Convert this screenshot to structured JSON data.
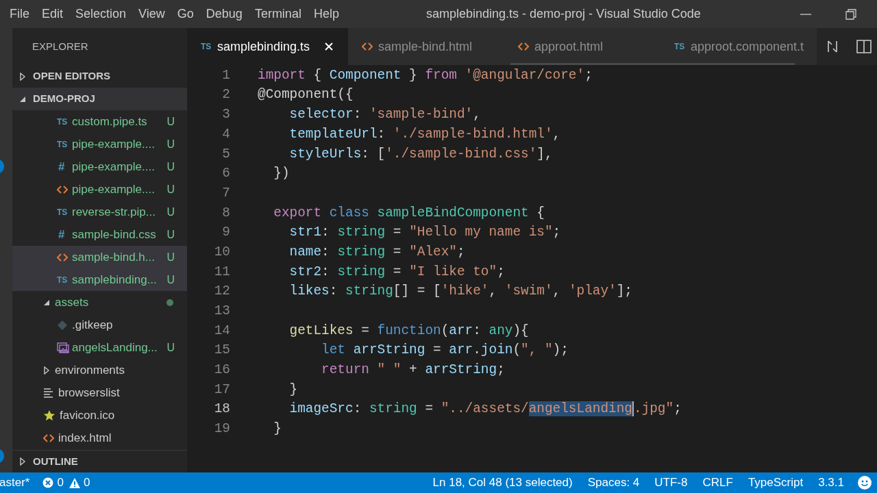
{
  "menu": [
    "File",
    "Edit",
    "Selection",
    "View",
    "Go",
    "Debug",
    "Terminal",
    "Help"
  ],
  "window": {
    "title": "samplebinding.ts - demo-proj - Visual Studio Code"
  },
  "sidebar": {
    "title": "EXPLORER",
    "sections": [
      {
        "label": "OPEN EDITORS",
        "expanded": false
      },
      {
        "label": "DEMO-PROJ",
        "expanded": true
      }
    ],
    "tree": [
      {
        "children": [
          {
            "label": "custom.pipe.ts",
            "icon": {
              "kind": "ts",
              "text": "TS"
            },
            "status": "U",
            "color": "#73c991",
            "selected": false
          },
          {
            "label": "pipe-example....",
            "icon": {
              "kind": "ts",
              "text": "TS"
            },
            "status": "U",
            "color": "#73c991",
            "selected": false
          },
          {
            "label": "pipe-example....",
            "icon": {
              "kind": "css",
              "text": "#"
            },
            "status": "U",
            "color": "#73c991",
            "selected": false
          },
          {
            "label": "pipe-example....",
            "icon": {
              "kind": "html"
            },
            "status": "U",
            "color": "#73c991",
            "selected": false
          },
          {
            "label": "reverse-str.pip...",
            "icon": {
              "kind": "ts",
              "text": "TS"
            },
            "status": "U",
            "color": "#73c991",
            "selected": false
          },
          {
            "label": "sample-bind.css",
            "icon": {
              "kind": "css",
              "text": "#"
            },
            "status": "U",
            "color": "#73c991",
            "selected": false
          },
          {
            "label": "sample-bind.h...",
            "icon": {
              "kind": "html"
            },
            "status": "U",
            "color": "#73c991",
            "selected": true
          },
          {
            "label": "samplebinding...",
            "icon": {
              "kind": "ts",
              "text": "TS"
            },
            "status": "U",
            "color": "#73c991",
            "selected": true
          }
        ]
      },
      {
        "label": "assets",
        "expanded": true,
        "color": "#73c991",
        "modified_dot": true,
        "selected": false,
        "children": [
          {
            "label": ".gitkeep",
            "icon": {
              "kind": "git"
            },
            "color": "#cccccc",
            "selected": false
          },
          {
            "label": "angelsLanding...",
            "icon": {
              "kind": "image"
            },
            "status": "U",
            "color": "#73c991",
            "selected": false
          }
        ]
      },
      {
        "label": "environments",
        "expanded": false,
        "color": "#cccccc",
        "selected": false
      },
      {
        "label": "browserslist",
        "icon": {
          "kind": "lines"
        },
        "color": "#cccccc",
        "selected": false
      },
      {
        "label": "favicon.ico",
        "icon": {
          "kind": "star"
        },
        "color": "#cccccc",
        "selected": false
      },
      {
        "label": "index.html",
        "icon": {
          "kind": "html"
        },
        "color": "#cccccc",
        "selected": false
      }
    ],
    "footer": {
      "label": "OUTLINE",
      "expanded": false
    }
  },
  "tabs": [
    {
      "label": "samplebinding.ts",
      "icon": {
        "kind": "ts",
        "text": "TS"
      },
      "selected": true
    },
    {
      "label": "sample-bind.html",
      "icon": {
        "kind": "html"
      },
      "selected": false
    },
    {
      "label": "approot.html",
      "icon": {
        "kind": "html"
      },
      "selected": false
    },
    {
      "label": "approot.component.t",
      "icon": {
        "kind": "ts",
        "text": "TS"
      },
      "selected": false
    }
  ],
  "editor": {
    "lines": [
      {
        "number": "1",
        "current": false,
        "tokens": [
          {
            "text": "import",
            "kind": "keyword"
          },
          {
            "text": " { ",
            "kind": "plain"
          },
          {
            "text": "Component",
            "kind": "variable"
          },
          {
            "text": " } ",
            "kind": "plain"
          },
          {
            "text": "from ",
            "kind": "keyword"
          },
          {
            "text": "'@angular/core'",
            "kind": "string"
          },
          {
            "text": ";",
            "kind": "plain"
          }
        ]
      },
      {
        "number": "2",
        "current": false,
        "tokens": [
          {
            "text": "@Component({",
            "kind": "plain"
          }
        ]
      },
      {
        "number": "3",
        "current": false,
        "tokens": [
          {
            "text": "    selector",
            "kind": "variable"
          },
          {
            "text": ": ",
            "kind": "plain"
          },
          {
            "text": "'sample-bind'",
            "kind": "string"
          },
          {
            "text": ",",
            "kind": "plain"
          }
        ]
      },
      {
        "number": "4",
        "current": false,
        "tokens": [
          {
            "text": "    templateUrl",
            "kind": "variable"
          },
          {
            "text": ": ",
            "kind": "plain"
          },
          {
            "text": "'./sample-bind.html'",
            "kind": "string"
          },
          {
            "text": ",",
            "kind": "plain"
          }
        ]
      },
      {
        "number": "5",
        "current": false,
        "tokens": [
          {
            "text": "    styleUrls",
            "kind": "variable"
          },
          {
            "text": ": [",
            "kind": "plain"
          },
          {
            "text": "'./sample-bind.css'",
            "kind": "string"
          },
          {
            "text": "],",
            "kind": "plain"
          }
        ]
      },
      {
        "number": "6",
        "current": false,
        "tokens": [
          {
            "text": "  })",
            "kind": "plain"
          }
        ]
      },
      {
        "number": "7",
        "current": false
      },
      {
        "number": "8",
        "current": false,
        "tokens": [
          {
            "text": "  export ",
            "kind": "keyword"
          },
          {
            "text": "class ",
            "kind": "storage"
          },
          {
            "text": "sampleBindComponent",
            "kind": "type"
          },
          {
            "text": " {",
            "kind": "plain"
          }
        ]
      },
      {
        "number": "9",
        "current": false,
        "tokens": [
          {
            "text": "    str1",
            "kind": "variable"
          },
          {
            "text": ": ",
            "kind": "plain"
          },
          {
            "text": "string",
            "kind": "type"
          },
          {
            "text": " = ",
            "kind": "plain"
          },
          {
            "text": "\"Hello my name is\"",
            "kind": "string"
          },
          {
            "text": ";",
            "kind": "plain"
          }
        ]
      },
      {
        "number": "10",
        "current": false,
        "tokens": [
          {
            "text": "    name",
            "kind": "variable"
          },
          {
            "text": ": ",
            "kind": "plain"
          },
          {
            "text": "string",
            "kind": "type"
          },
          {
            "text": " = ",
            "kind": "plain"
          },
          {
            "text": "\"Alex\"",
            "kind": "string"
          },
          {
            "text": ";",
            "kind": "plain"
          }
        ]
      },
      {
        "number": "11",
        "current": false,
        "tokens": [
          {
            "text": "    str2",
            "kind": "variable"
          },
          {
            "text": ": ",
            "kind": "plain"
          },
          {
            "text": "string",
            "kind": "type"
          },
          {
            "text": " = ",
            "kind": "plain"
          },
          {
            "text": "\"I like to\"",
            "kind": "string"
          },
          {
            "text": ";",
            "kind": "plain"
          }
        ]
      },
      {
        "number": "12",
        "current": false,
        "tokens": [
          {
            "text": "    likes",
            "kind": "variable"
          },
          {
            "text": ": ",
            "kind": "plain"
          },
          {
            "text": "string",
            "kind": "type"
          },
          {
            "text": "[] = [",
            "kind": "plain"
          },
          {
            "text": "'hike'",
            "kind": "string"
          },
          {
            "text": ", ",
            "kind": "plain"
          },
          {
            "text": "'swim'",
            "kind": "string"
          },
          {
            "text": ", ",
            "kind": "plain"
          },
          {
            "text": "'play'",
            "kind": "string"
          },
          {
            "text": "];",
            "kind": "plain"
          }
        ]
      },
      {
        "number": "13",
        "current": false
      },
      {
        "number": "14",
        "current": false,
        "tokens": [
          {
            "text": "    getLikes",
            "kind": "function"
          },
          {
            "text": " = ",
            "kind": "plain"
          },
          {
            "text": "function",
            "kind": "storage"
          },
          {
            "text": "(",
            "kind": "plain"
          },
          {
            "text": "arr",
            "kind": "variable"
          },
          {
            "text": ": ",
            "kind": "plain"
          },
          {
            "text": "any",
            "kind": "type"
          },
          {
            "text": "){",
            "kind": "plain"
          }
        ]
      },
      {
        "number": "15",
        "current": false,
        "tokens": [
          {
            "text": "        let ",
            "kind": "storage"
          },
          {
            "text": "arrString",
            "kind": "variable"
          },
          {
            "text": " = ",
            "kind": "plain"
          },
          {
            "text": "arr",
            "kind": "variable"
          },
          {
            "text": ".",
            "kind": "plain"
          },
          {
            "text": "join",
            "kind": "variable"
          },
          {
            "text": "(",
            "kind": "plain"
          },
          {
            "text": "\", \"",
            "kind": "string"
          },
          {
            "text": ");",
            "kind": "plain"
          }
        ]
      },
      {
        "number": "16",
        "current": false,
        "tokens": [
          {
            "text": "        return ",
            "kind": "keyword"
          },
          {
            "text": "\" \"",
            "kind": "string"
          },
          {
            "text": " + ",
            "kind": "plain"
          },
          {
            "text": "arrString",
            "kind": "variable"
          },
          {
            "text": ";",
            "kind": "plain"
          }
        ]
      },
      {
        "number": "17",
        "current": false,
        "tokens": [
          {
            "text": "    }",
            "kind": "plain"
          }
        ]
      },
      {
        "number": "18",
        "current": true,
        "tokens": [
          {
            "text": "    imageSrc",
            "kind": "variable"
          },
          {
            "text": ": ",
            "kind": "plain"
          },
          {
            "text": "string",
            "kind": "type"
          },
          {
            "text": " = ",
            "kind": "plain"
          },
          {
            "text": "\"../assets/",
            "kind": "string"
          },
          {
            "text": "angelsLanding",
            "kind": "selection"
          },
          {
            "text": ".jpg\"",
            "kind": "string"
          },
          {
            "text": ";",
            "kind": "plain"
          }
        ]
      },
      {
        "number": "19",
        "current": false,
        "tokens": [
          {
            "text": "  }",
            "kind": "plain"
          }
        ]
      }
    ]
  },
  "status_bar": {
    "branch": "aster*",
    "errors": "0",
    "warnings": "0",
    "items": [
      "Ln 18, Col 48 (13 selected)",
      "Spaces: 4",
      "UTF-8",
      "CRLF",
      "TypeScript",
      "3.3.1"
    ]
  }
}
